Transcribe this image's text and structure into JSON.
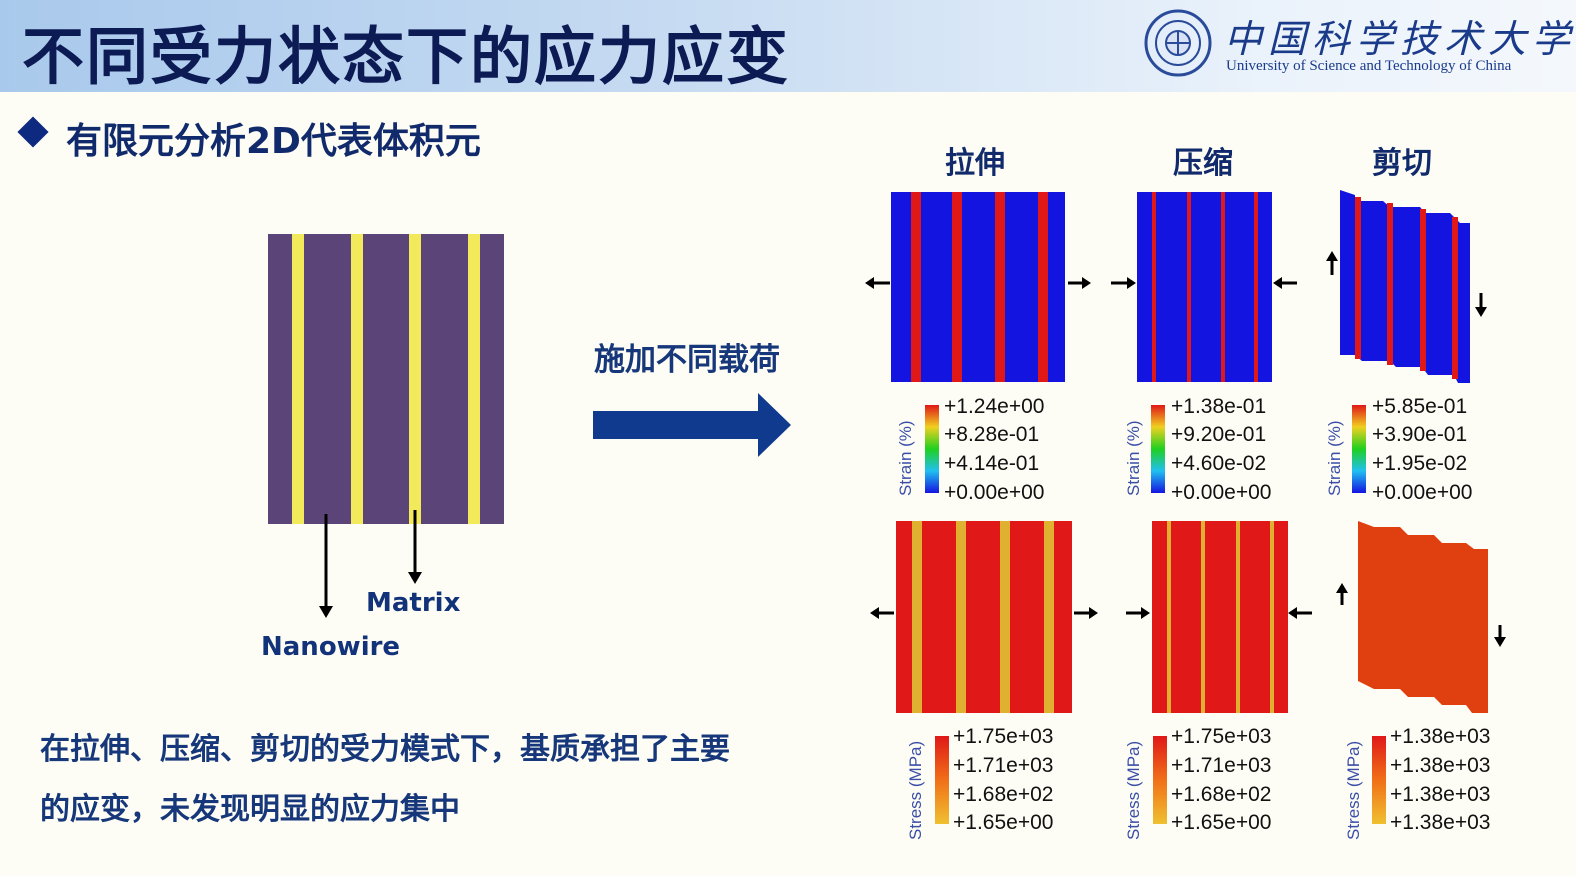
{
  "header": {
    "title": "不同受力状态下的应力应变",
    "university_cn": "中国科学技术大学",
    "university_en": "University of Science and Technology of China"
  },
  "subtitle": "有限元分析2D代表体积元",
  "rve": {
    "label_matrix": "Matrix",
    "label_nanowire": "Nanowire",
    "matrix_color": "#5b4478",
    "nanowire_color": "#f2ea5a"
  },
  "arrow_label": "施加不同载荷",
  "columns": [
    {
      "title": "拉伸"
    },
    {
      "title": "压缩"
    },
    {
      "title": "剪切"
    }
  ],
  "strain_legends": [
    {
      "title": "Strain (%)",
      "values": [
        "+1.24e+00",
        "+8.28e-01",
        "+4.14e-01",
        "+0.00e+00"
      ]
    },
    {
      "title": "Strain (%)",
      "values": [
        "+1.38e-01",
        "+9.20e-01",
        "+4.60e-02",
        "+0.00e+00"
      ]
    },
    {
      "title": "Strain (%)",
      "values": [
        "+5.85e-01",
        "+3.90e-01",
        "+1.95e-02",
        "+0.00e+00"
      ]
    }
  ],
  "stress_legends": [
    {
      "title": "Stress (MPa)",
      "values": [
        "+1.75e+03",
        "+1.71e+03",
        "+1.68e+02",
        "+1.65e+00"
      ]
    },
    {
      "title": "Stress (MPa)",
      "values": [
        "+1.75e+03",
        "+1.71e+03",
        "+1.68e+02",
        "+1.65e+00"
      ]
    },
    {
      "title": "Stress (MPa)",
      "values": [
        "+1.38e+03",
        "+1.38e+03",
        "+1.38e+03",
        "+1.38e+03"
      ]
    }
  ],
  "conclusion": {
    "line1": "在拉伸、压缩、剪切的受力模式下，基质承担了主要",
    "line2": "的应变，未发现明显的应力集中"
  },
  "colors": {
    "strain_low": "#1414e0",
    "strain_high": "#e01818",
    "stress_matrix": "#e01818",
    "stress_wire": "#e0b030",
    "shear_stress": "#e04010"
  }
}
